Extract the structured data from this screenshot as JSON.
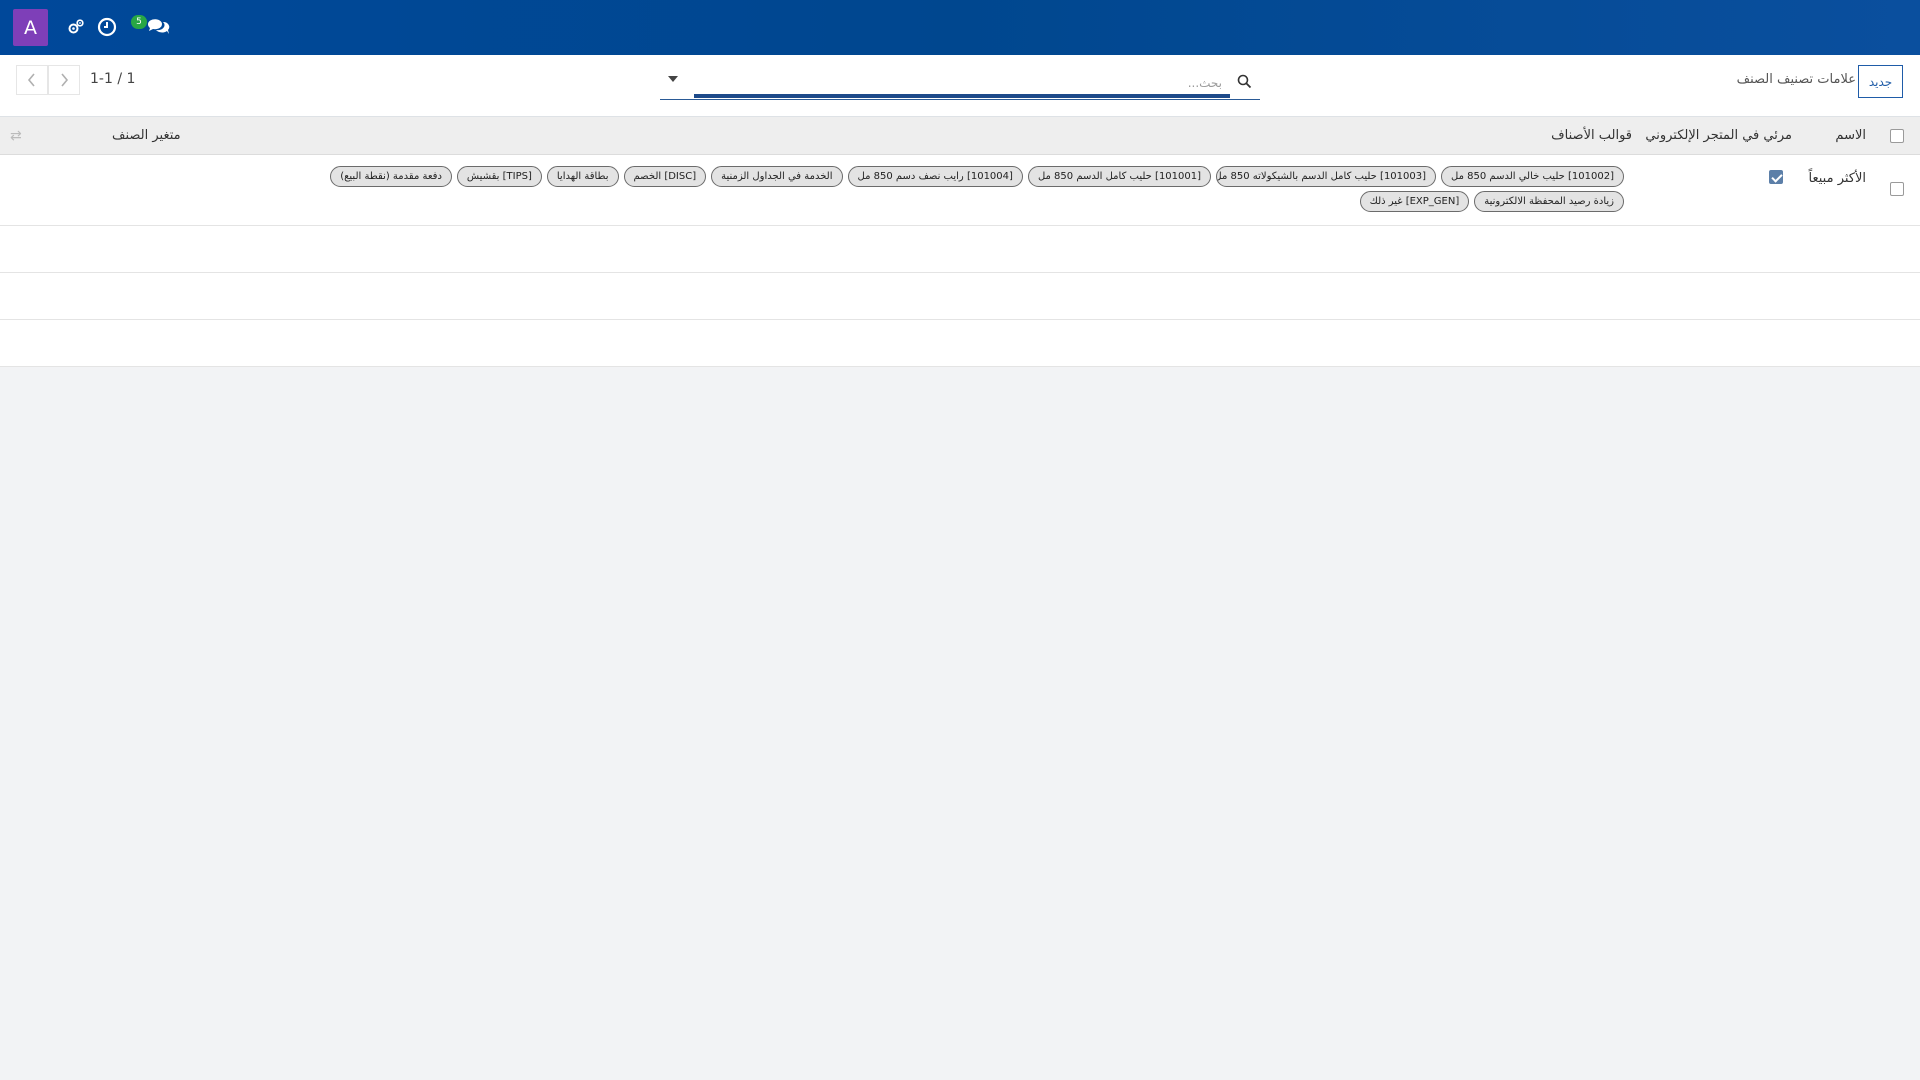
{
  "navbar": {
    "avatar_letter": "A",
    "messages_badge": "5",
    "icons": [
      "gears-icon",
      "clock-icon",
      "chat-icon"
    ],
    "accent": "#00489a",
    "avatar_color": "#7e3fb8"
  },
  "control_panel": {
    "pager_value": "1-1 / 1",
    "search_placeholder": "بحث...",
    "new_button": "جديد",
    "breadcrumb": "علامات تصنيف الصنف"
  },
  "list": {
    "columns": {
      "name": "الاسم",
      "website_visible": "مرئي في المتجر الإلكتروني",
      "product_templates": "قوالب الأصناف",
      "product_variant": "متغير الصنف"
    },
    "rows": [
      {
        "name": "الأكثر مبيعاً",
        "website_visible": true,
        "tags": [
          "[101002] حليب خالي الدسم 850 مل",
          "[101003] حليب كامل الدسم بالشيكولاته 850 مل",
          "[101001] حليب كامل الدسم 850 مل",
          "[101004] رايب نصف دسم 850 مل",
          "الخدمة في الجداول الزمنية",
          "[DISC] الخصم",
          "بطاقة الهدايا",
          "[TIPS] بقشيش",
          "دفعة مقدمة (نقطة البيع)",
          "زيادة رصيد المحفظة الالكترونية",
          "[EXP_GEN] غير ذلك"
        ]
      }
    ]
  }
}
